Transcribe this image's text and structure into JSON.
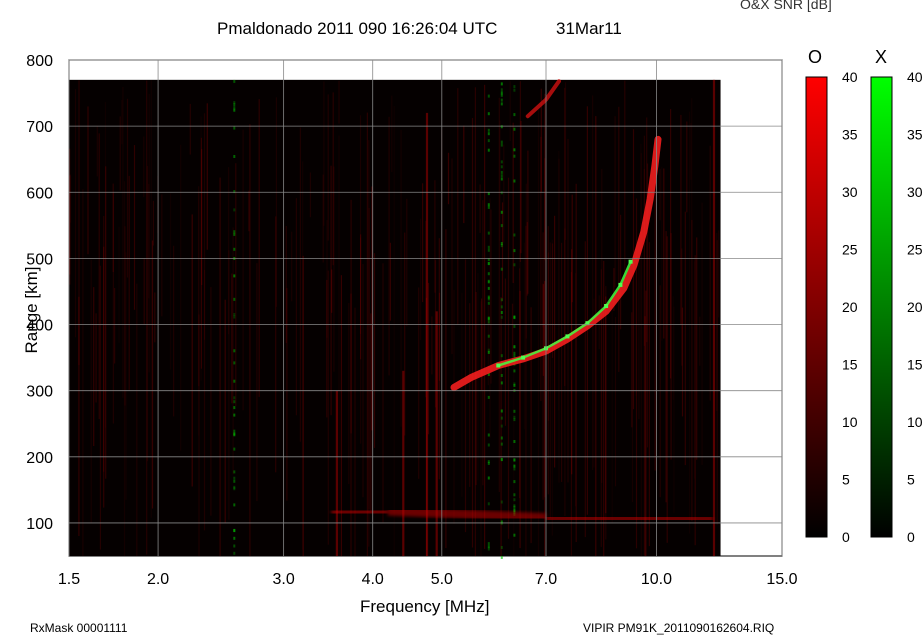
{
  "header": {
    "title": "Pmaldonado 2011 090 16:26:04 UTC",
    "date": "31Mar11",
    "snr_label": "O&X SNR [dB]"
  },
  "footer": {
    "left": "RxMask 00001111",
    "right": "VIPIR  PM91K_20110901626​04.RIQ"
  },
  "colorbars": [
    {
      "name": "O",
      "min": 0,
      "max": 40,
      "ticks": [
        "40",
        "35",
        "30",
        "25",
        "20",
        "15",
        "10",
        "5",
        "0"
      ],
      "color_top": "#ff0000",
      "color_bottom": "#000000"
    },
    {
      "name": "X",
      "min": 0,
      "max": 40,
      "ticks": [
        "40",
        "35",
        "30",
        "25",
        "20",
        "15",
        "10",
        "5",
        "0"
      ],
      "color_top": "#00ff00",
      "color_bottom": "#000000"
    }
  ],
  "chart_data": {
    "type": "heatmap",
    "xlabel": "Frequency [MHz]",
    "ylabel": "Range [km]",
    "x_scale": "log",
    "xlim": [
      1.5,
      15.0
    ],
    "ylim": [
      50,
      800
    ],
    "x_ticks": [
      {
        "value": 1.5,
        "label": "1.5"
      },
      {
        "value": 2.0,
        "label": "2.0"
      },
      {
        "value": 3.0,
        "label": "3.0"
      },
      {
        "value": 4.0,
        "label": "4.0"
      },
      {
        "value": 5.0,
        "label": "5.0"
      },
      {
        "value": 7.0,
        "label": "7.0"
      },
      {
        "value": 10.0,
        "label": "10.0"
      },
      {
        "value": 15.0,
        "label": "15.0"
      }
    ],
    "y_ticks": [
      {
        "value": 100,
        "label": "100"
      },
      {
        "value": 200,
        "label": "200"
      },
      {
        "value": 300,
        "label": "300"
      },
      {
        "value": 400,
        "label": "400"
      },
      {
        "value": 500,
        "label": "500"
      },
      {
        "value": 600,
        "label": "600"
      },
      {
        "value": 700,
        "label": "700"
      },
      {
        "value": 800,
        "label": "800"
      }
    ],
    "grid": true,
    "data_extent": {
      "x_max": 12.3,
      "y_max": 770
    },
    "o_trace": [
      {
        "x": 5.2,
        "y": 305
      },
      {
        "x": 5.5,
        "y": 320
      },
      {
        "x": 6.0,
        "y": 338
      },
      {
        "x": 6.5,
        "y": 348
      },
      {
        "x": 7.0,
        "y": 360
      },
      {
        "x": 7.5,
        "y": 378
      },
      {
        "x": 8.0,
        "y": 398
      },
      {
        "x": 8.5,
        "y": 420
      },
      {
        "x": 9.0,
        "y": 455
      },
      {
        "x": 9.3,
        "y": 490
      },
      {
        "x": 9.6,
        "y": 540
      },
      {
        "x": 9.8,
        "y": 590
      },
      {
        "x": 9.95,
        "y": 640
      },
      {
        "x": 10.05,
        "y": 680
      }
    ],
    "x_trace": [
      {
        "x": 6.0,
        "y": 338
      },
      {
        "x": 6.5,
        "y": 350
      },
      {
        "x": 7.0,
        "y": 364
      },
      {
        "x": 7.5,
        "y": 382
      },
      {
        "x": 8.0,
        "y": 402
      },
      {
        "x": 8.5,
        "y": 428
      },
      {
        "x": 8.9,
        "y": 460
      },
      {
        "x": 9.2,
        "y": 495
      }
    ],
    "o_upper_trace": [
      {
        "x": 6.6,
        "y": 715
      },
      {
        "x": 7.0,
        "y": 740
      },
      {
        "x": 7.3,
        "y": 768
      }
    ],
    "e_layer": [
      {
        "x": 3.5,
        "y": 115
      },
      {
        "x": 4.2,
        "y": 118
      },
      {
        "x": 7.0,
        "y": 108
      },
      {
        "x": 12.0,
        "y": 105
      }
    ]
  }
}
